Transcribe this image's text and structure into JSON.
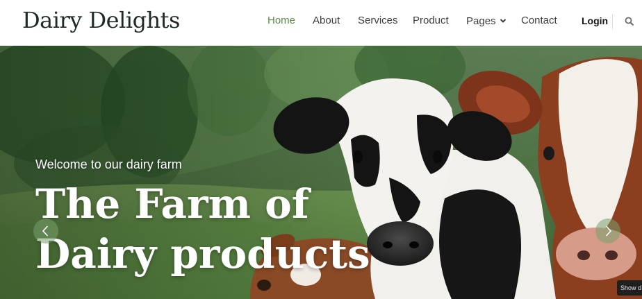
{
  "brand": {
    "name": "Dairy Delights"
  },
  "nav": {
    "items": [
      {
        "label": "Home",
        "active": true
      },
      {
        "label": "About",
        "active": false
      },
      {
        "label": "Services",
        "active": false
      },
      {
        "label": "Product",
        "active": false
      },
      {
        "label": "Pages",
        "active": false,
        "has_dropdown": true
      },
      {
        "label": "Contact",
        "active": false
      }
    ],
    "login_label": "Login",
    "search_icon": "search-icon"
  },
  "hero": {
    "kicker": "Welcome to our dairy farm",
    "title_line1": "The Farm of",
    "title_line2": "Dairy products",
    "prev_icon": "chevron-left-icon",
    "next_icon": "chevron-right-icon",
    "side_tab_label": "Show d"
  },
  "colors": {
    "accent": "#5b8a4d",
    "brand_text": "#1e2b26",
    "nav_text": "#3d3d3d",
    "hero_text": "#ffffff"
  }
}
